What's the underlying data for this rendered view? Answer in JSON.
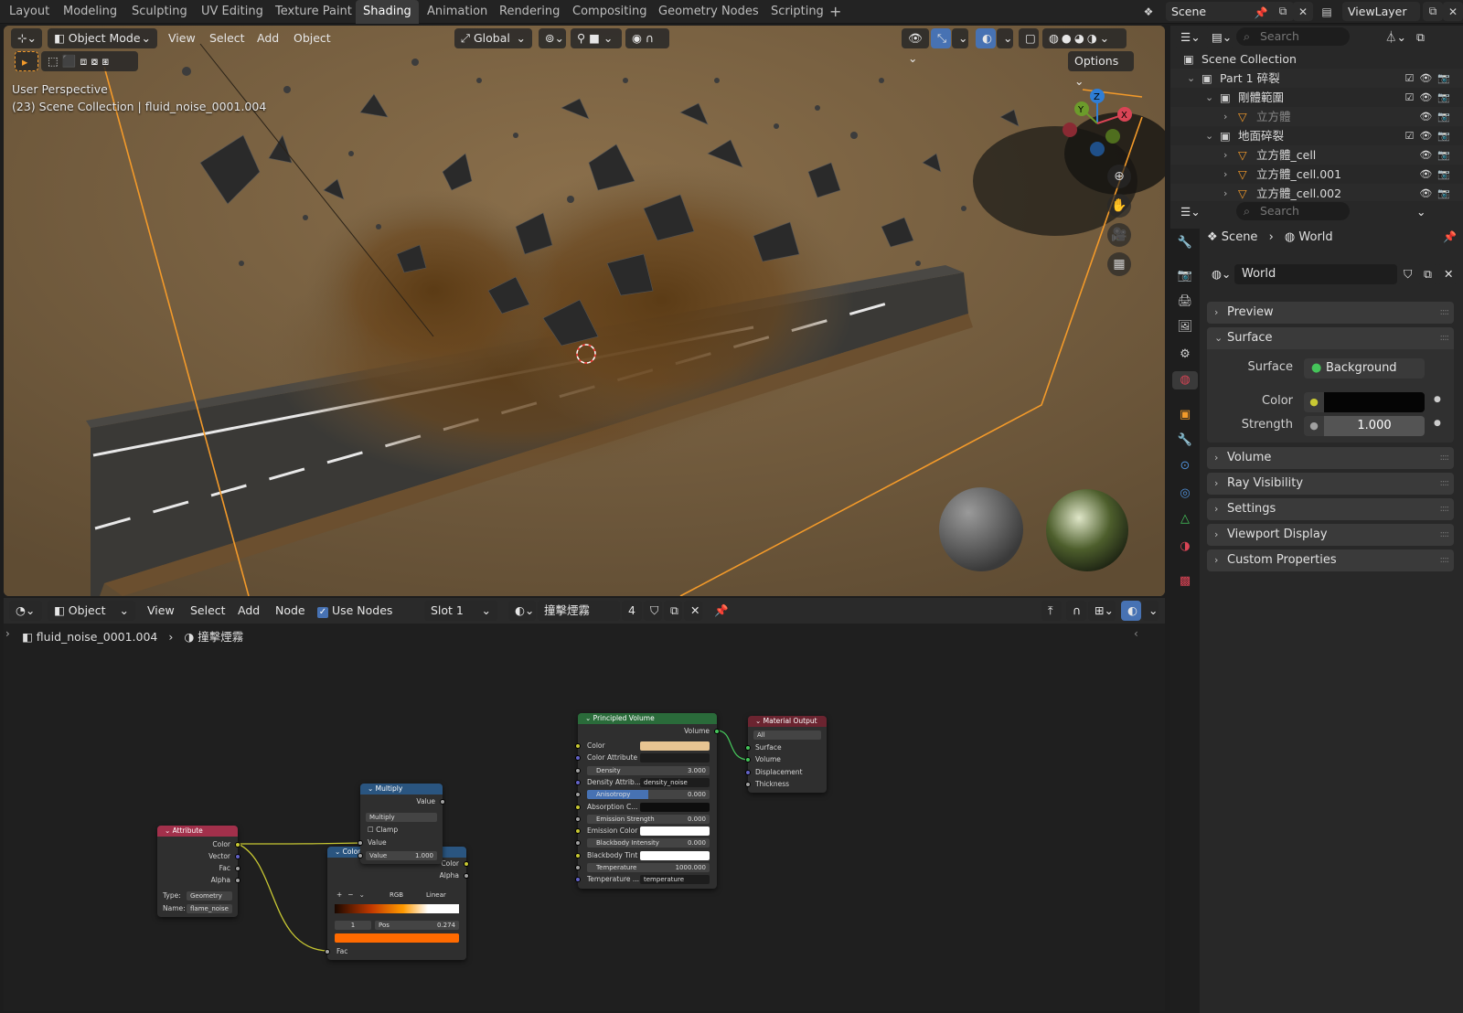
{
  "workspace_tabs": [
    "Layout",
    "Modeling",
    "Sculpting",
    "UV Editing",
    "Texture Paint",
    "Shading",
    "Animation",
    "Rendering",
    "Compositing",
    "Geometry Nodes",
    "Scripting"
  ],
  "active_tab": "Shading",
  "scene_field": "Scene",
  "viewlayer_field": "ViewLayer",
  "viewport": {
    "mode": "Object Mode",
    "menus": [
      "View",
      "Select",
      "Add",
      "Object"
    ],
    "transform_orientation": "Global",
    "options_label": "Options",
    "overlay_line1": "User Perspective",
    "overlay_line2": "(23) Scene Collection | fluid_noise_0001.004",
    "gizmo_axes": [
      "Z",
      "Y",
      "X"
    ]
  },
  "node_editor": {
    "context": "Object",
    "menus": [
      "View",
      "Select",
      "Add",
      "Node"
    ],
    "use_nodes_label": "Use Nodes",
    "slot": "Slot 1",
    "material_name": "撞擊煙霧",
    "user_count": "4",
    "breadcrumb_object": "fluid_noise_0001.004",
    "breadcrumb_material": "撞擊煙霧",
    "nodes": {
      "attribute": {
        "title": "Attribute",
        "outputs": [
          "Color",
          "Vector",
          "Fac",
          "Alpha"
        ],
        "type_label": "Type:",
        "type_value": "Geometry",
        "name_label": "Name:",
        "name_value": "flame_noise"
      },
      "multiply": {
        "title": "Multiply",
        "output": "Value",
        "op": "Multiply",
        "clamp": "Clamp",
        "input": "Value",
        "value_label": "Value",
        "value": "1.000"
      },
      "colorramp": {
        "title": "Color",
        "outputs": [
          "Color",
          "Alpha"
        ],
        "mode": "RGB",
        "interp": "Linear",
        "index": "1",
        "pos_label": "Pos",
        "pos": "0.274",
        "input": "Fac"
      },
      "principled": {
        "title": "Principled Volume",
        "output": "Volume",
        "rows": [
          {
            "label": "Color",
            "value": ""
          },
          {
            "label": "Color Attribute",
            "value": ""
          },
          {
            "label": "Density",
            "value": "3.000"
          },
          {
            "label": "Density Attrib...",
            "value": "density_noise"
          },
          {
            "label": "Anisotropy",
            "value": "0.000"
          },
          {
            "label": "Absorption C...",
            "value": ""
          },
          {
            "label": "Emission Strength",
            "value": "0.000"
          },
          {
            "label": "Emission Color",
            "value": ""
          },
          {
            "label": "Blackbody Intensity",
            "value": "0.000"
          },
          {
            "label": "Blackbody Tint",
            "value": ""
          },
          {
            "label": "Temperature",
            "value": "1000.000"
          },
          {
            "label": "Temperature ...",
            "value": "temperature"
          }
        ]
      },
      "output": {
        "title": "Material Output",
        "target": "All",
        "inputs": [
          "Surface",
          "Volume",
          "Displacement",
          "Thickness"
        ]
      }
    }
  },
  "outliner": {
    "search_placeholder": "Search",
    "rows": [
      {
        "label": "Scene Collection",
        "indent": 0
      },
      {
        "label": "Part 1 碎裂",
        "indent": 1
      },
      {
        "label": "剛體範圍",
        "indent": 2
      },
      {
        "label": "立方體",
        "indent": 3
      },
      {
        "label": "地面碎裂",
        "indent": 2
      },
      {
        "label": "立方體_cell",
        "indent": 3
      },
      {
        "label": "立方體_cell.001",
        "indent": 3
      },
      {
        "label": "立方體_cell.002",
        "indent": 3
      }
    ]
  },
  "properties": {
    "search_placeholder": "Search",
    "breadcrumb": [
      "Scene",
      "World"
    ],
    "world_name": "World",
    "panels": [
      "Preview",
      "Surface",
      "Volume",
      "Ray Visibility",
      "Settings",
      "Viewport Display",
      "Custom Properties"
    ],
    "surface_label": "Surface",
    "surface_value": "Background",
    "color_label": "Color",
    "strength_label": "Strength",
    "strength_value": "1.000"
  },
  "colors": {
    "accent": "#4772b3",
    "selected_orange": "#f39a2a",
    "principled_header": "#2a6b3a",
    "attribute_header": "#a2304b",
    "output_header": "#6b2430",
    "vector_header": "#2a5580"
  }
}
